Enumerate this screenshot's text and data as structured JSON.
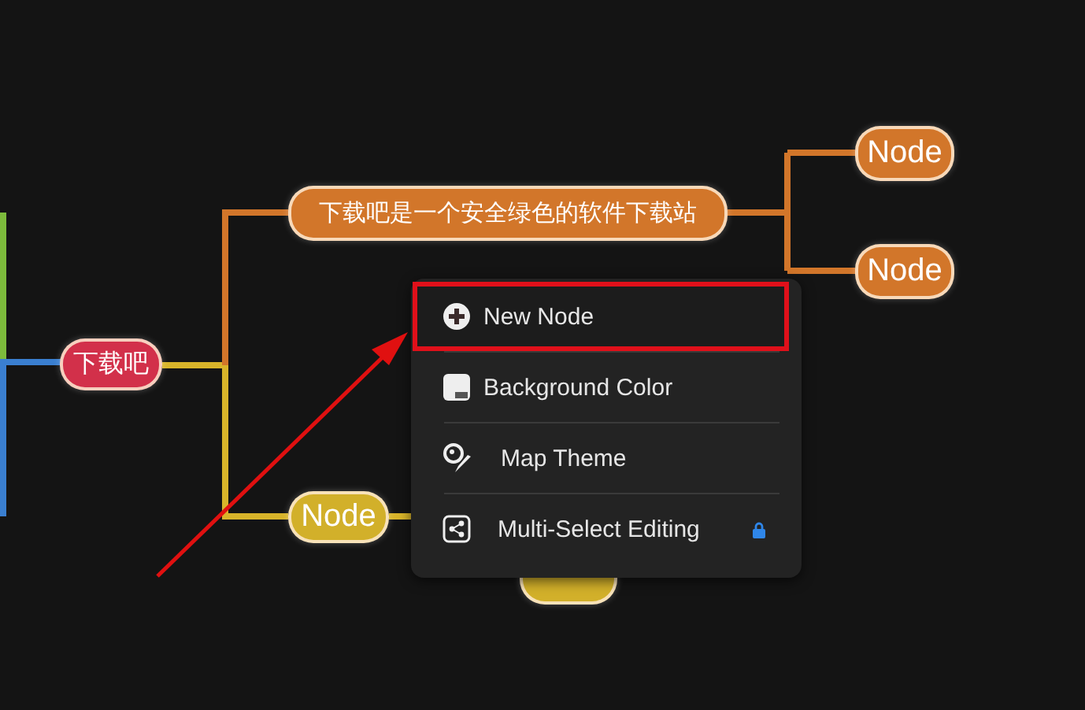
{
  "mind_map": {
    "nodes": [
      {
        "text": "下载吧",
        "color": "#d2304a",
        "kind": "root"
      },
      {
        "text": "下载吧是一个安全绿色的软件下载站",
        "color": "#d2762a",
        "kind": "branch"
      },
      {
        "text": "Node",
        "color": "#d2762a",
        "kind": "leaf"
      },
      {
        "text": "Node",
        "color": "#d2762a",
        "kind": "leaf"
      },
      {
        "text": "Node",
        "color": "#d2b02a",
        "kind": "leaf"
      },
      {
        "color": "#d2b02a",
        "kind": "leaf"
      }
    ]
  },
  "context_menu": {
    "items": [
      {
        "label": "New Node",
        "kind": "add",
        "selected": true,
        "locked": false
      },
      {
        "label": "Background Color",
        "kind": "background",
        "selected": false,
        "locked": false
      },
      {
        "label": "Map Theme",
        "kind": "theme",
        "selected": false,
        "locked": false
      },
      {
        "label": "Multi-Select Editing",
        "kind": "multi",
        "selected": false,
        "locked": true
      }
    ]
  }
}
